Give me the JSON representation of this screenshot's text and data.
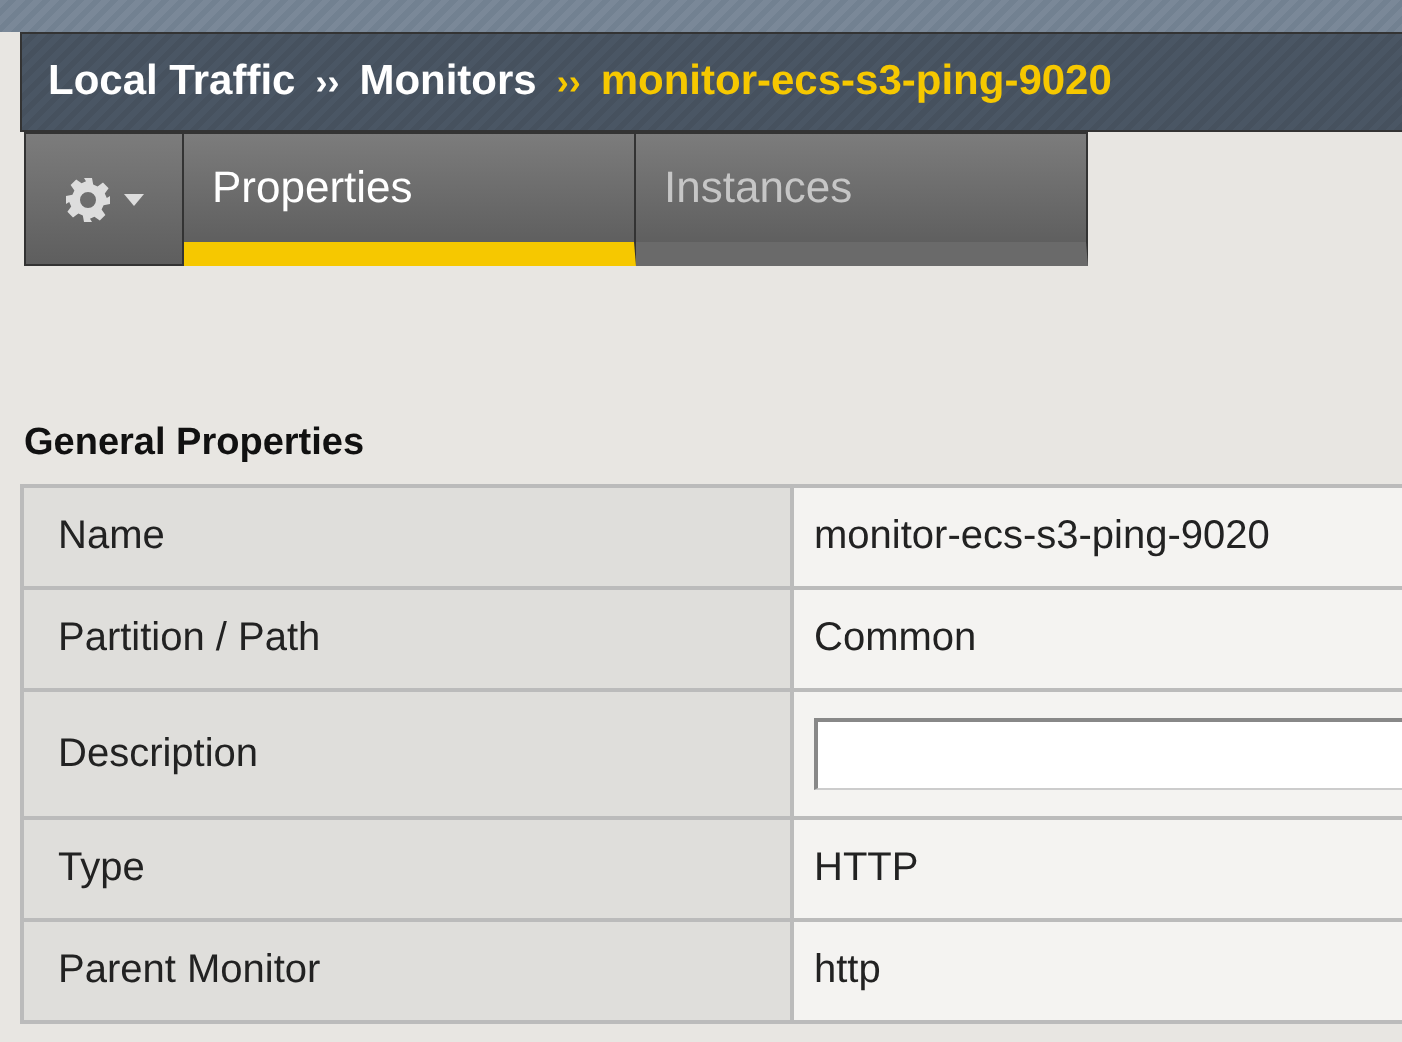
{
  "breadcrumb": [
    {
      "label": "Local Traffic",
      "current": false
    },
    {
      "separator": "››",
      "label": "Monitors",
      "current": false
    },
    {
      "separator": "››",
      "label": "monitor-ecs-s3-ping-9020",
      "current": true
    }
  ],
  "tabs": [
    {
      "label": "Properties",
      "selected": true
    },
    {
      "label": "Instances",
      "selected": false
    }
  ],
  "section_title": "General Properties",
  "rows": [
    {
      "kind": "text",
      "label": "Name",
      "value": "monitor-ecs-s3-ping-9020"
    },
    {
      "kind": "text",
      "label": "Partition / Path",
      "value": "Common"
    },
    {
      "kind": "input",
      "label": "Description"
    },
    {
      "kind": "text",
      "label": "Type",
      "value": "HTTP"
    },
    {
      "kind": "text",
      "label": "Parent Monitor",
      "value": "http"
    }
  ]
}
